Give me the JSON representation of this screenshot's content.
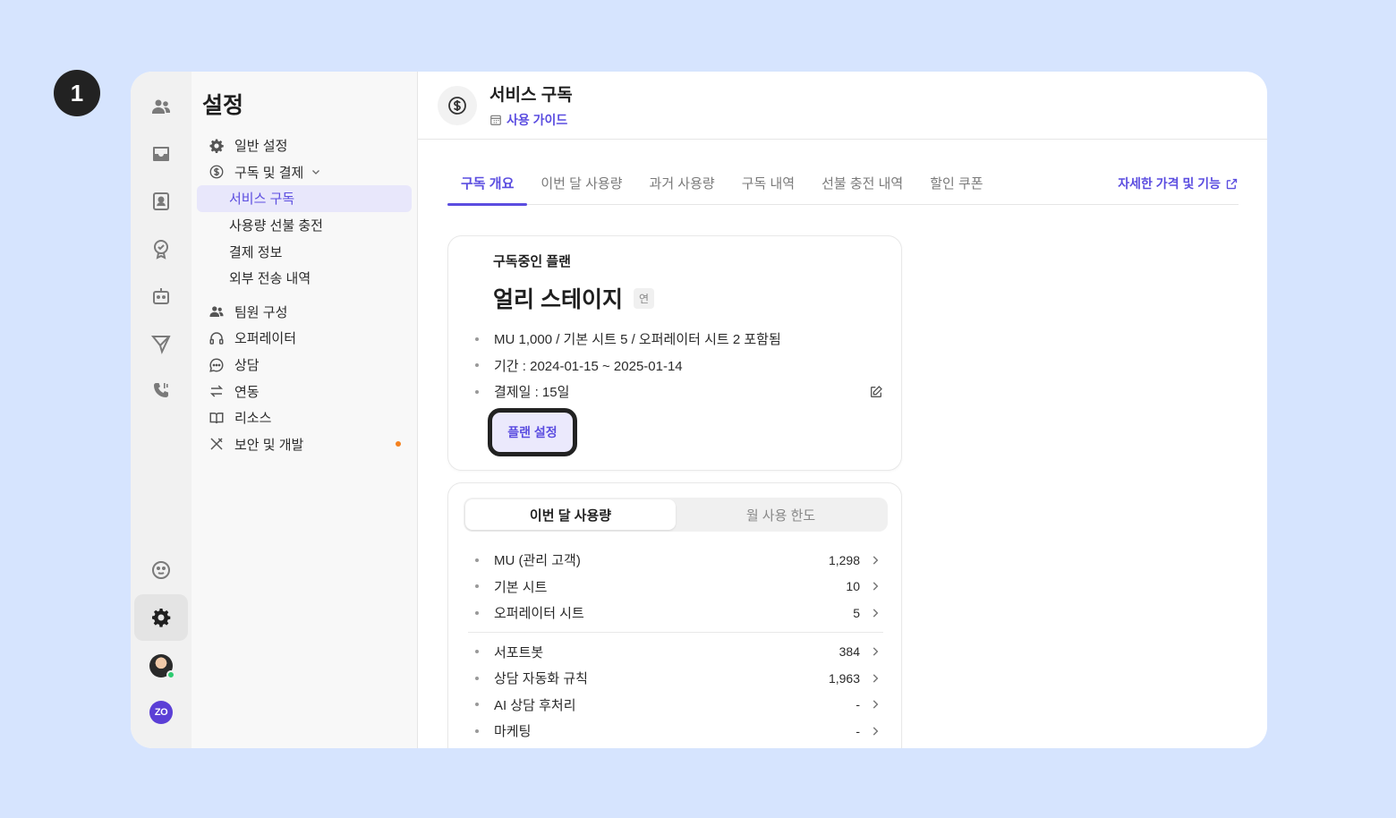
{
  "step_number": "1",
  "sidebar": {
    "title": "설정",
    "items": [
      {
        "label": "일반 설정",
        "icon": "gear-icon"
      },
      {
        "label": "구독 및 결제",
        "icon": "dollar-icon"
      },
      {
        "label": "서비스 구독"
      },
      {
        "label": "사용량 선불 충전"
      },
      {
        "label": "결제 정보"
      },
      {
        "label": "외부 전송 내역"
      },
      {
        "label": "팀원 구성",
        "icon": "team-icon"
      },
      {
        "label": "오퍼레이터",
        "icon": "headset-icon"
      },
      {
        "label": "상담",
        "icon": "chat-icon"
      },
      {
        "label": "연동",
        "icon": "swap-arrows-icon"
      },
      {
        "label": "리소스",
        "icon": "book-icon"
      },
      {
        "label": "보안 및 개발",
        "icon": "tools-icon"
      }
    ]
  },
  "header": {
    "title": "서비스 구독",
    "guide_link": "사용 가이드"
  },
  "tabs": {
    "items": [
      "구독 개요",
      "이번 달 사용량",
      "과거 사용량",
      "구독 내역",
      "선불 충전 내역",
      "할인 쿠폰"
    ],
    "active": "구독 개요",
    "pricing_link": "자세한 가격 및 기능"
  },
  "plan": {
    "caption": "구독중인 플랜",
    "name": "얼리 스테이지",
    "tag": "연",
    "details": [
      "MU 1,000 / 기본 시트 5 / 오퍼레이터 시트 2 포함됨",
      "기간 : 2024-01-15 ~ 2025-01-14",
      "결제일 : 15일"
    ],
    "button": "플랜 설정"
  },
  "usage": {
    "segments": [
      "이번 달 사용량",
      "월 사용 한도"
    ],
    "group1": [
      {
        "label": "MU (관리 고객)",
        "value": "1,298"
      },
      {
        "label": "기본 시트",
        "value": "10"
      },
      {
        "label": "오퍼레이터 시트",
        "value": "5"
      }
    ],
    "group2": [
      {
        "label": "서포트봇",
        "value": "384"
      },
      {
        "label": "상담 자동화 규칙",
        "value": "1,963"
      },
      {
        "label": "AI 상담 후처리",
        "value": "-"
      },
      {
        "label": "마케팅",
        "value": "-"
      }
    ]
  },
  "colors": {
    "accent": "#5b4de0",
    "background": "#d6e4fe",
    "notification_dot": "#f5821f"
  }
}
